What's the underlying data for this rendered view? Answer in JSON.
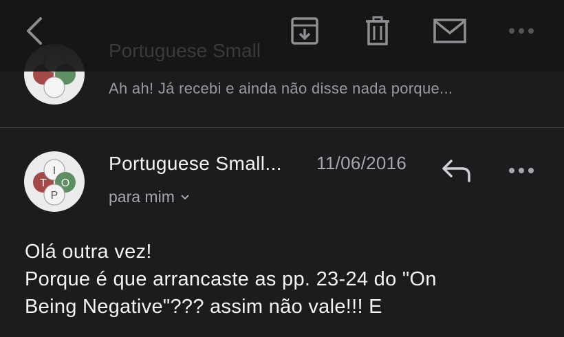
{
  "toolbar": {
    "back_icon": "chevron-left-icon",
    "archive_icon": "archive-icon",
    "trash_icon": "trash-icon",
    "mail_icon": "envelope-icon",
    "more_icon": "more-horizontal-icon"
  },
  "previous_message": {
    "sender": "Portuguese Small",
    "preview": "Ah ah! Já recebi e ainda não disse nada porque..."
  },
  "message": {
    "sender": "Portuguese Small...",
    "date": "11/06/2016",
    "recipient": "para mim",
    "reply_icon": "reply-icon",
    "more_icon": "more-horizontal-icon",
    "avatar_letters": [
      "T",
      "I",
      "O",
      "P"
    ],
    "body_lines": [
      "Olá outra vez!",
      "Porque é que arrancaste as pp. 23-24 do \"On",
      "Being Negative\"??? assim não vale!!! E"
    ]
  },
  "colors": {
    "background": "#1c1c1e",
    "toolbar": "#161617",
    "avatar_red": "#a34a49",
    "avatar_green": "#5e8e62",
    "avatar_white": "#f1f1f1"
  }
}
